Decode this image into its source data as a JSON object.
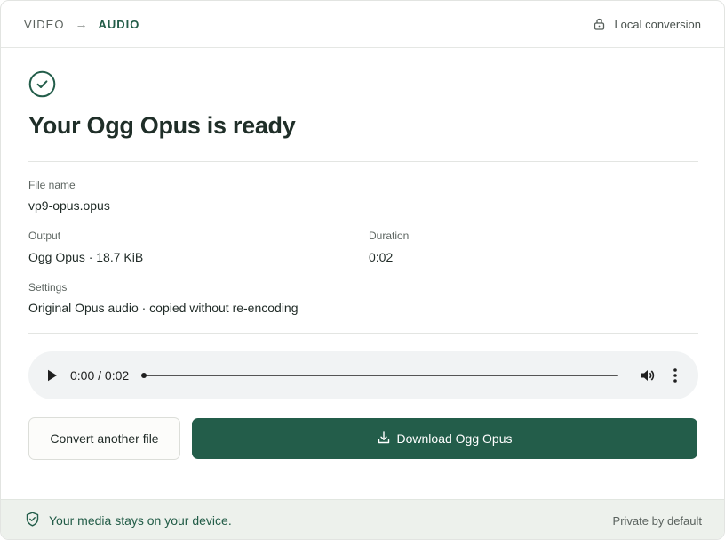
{
  "header": {
    "crumb_from": "VIDEO",
    "crumb_arrow": "→",
    "crumb_to": "AUDIO",
    "local_label": "Local conversion"
  },
  "main": {
    "title": "Your Ogg Opus is ready",
    "file_name_label": "File name",
    "file_name_value": "vp9-opus.opus",
    "output_label": "Output",
    "output_value": "Ogg Opus · 18.7 KiB",
    "duration_label": "Duration",
    "duration_value": "0:02",
    "settings_label": "Settings",
    "settings_value": "Original Opus audio · copied without re-encoding"
  },
  "player": {
    "time": "0:00 / 0:02",
    "progress": 0
  },
  "actions": {
    "convert_label": "Convert another file",
    "download_label": "Download Ogg Opus"
  },
  "footer": {
    "left_text": "Your media stays on your device.",
    "right_text": "Private by default"
  },
  "colors": {
    "accent": "#235d4a",
    "footer_bg": "#edf1ec"
  },
  "icons": [
    "lock-icon",
    "check-circle-icon",
    "play-icon",
    "volume-icon",
    "more-vert-icon",
    "download-icon",
    "shield-check-icon"
  ]
}
